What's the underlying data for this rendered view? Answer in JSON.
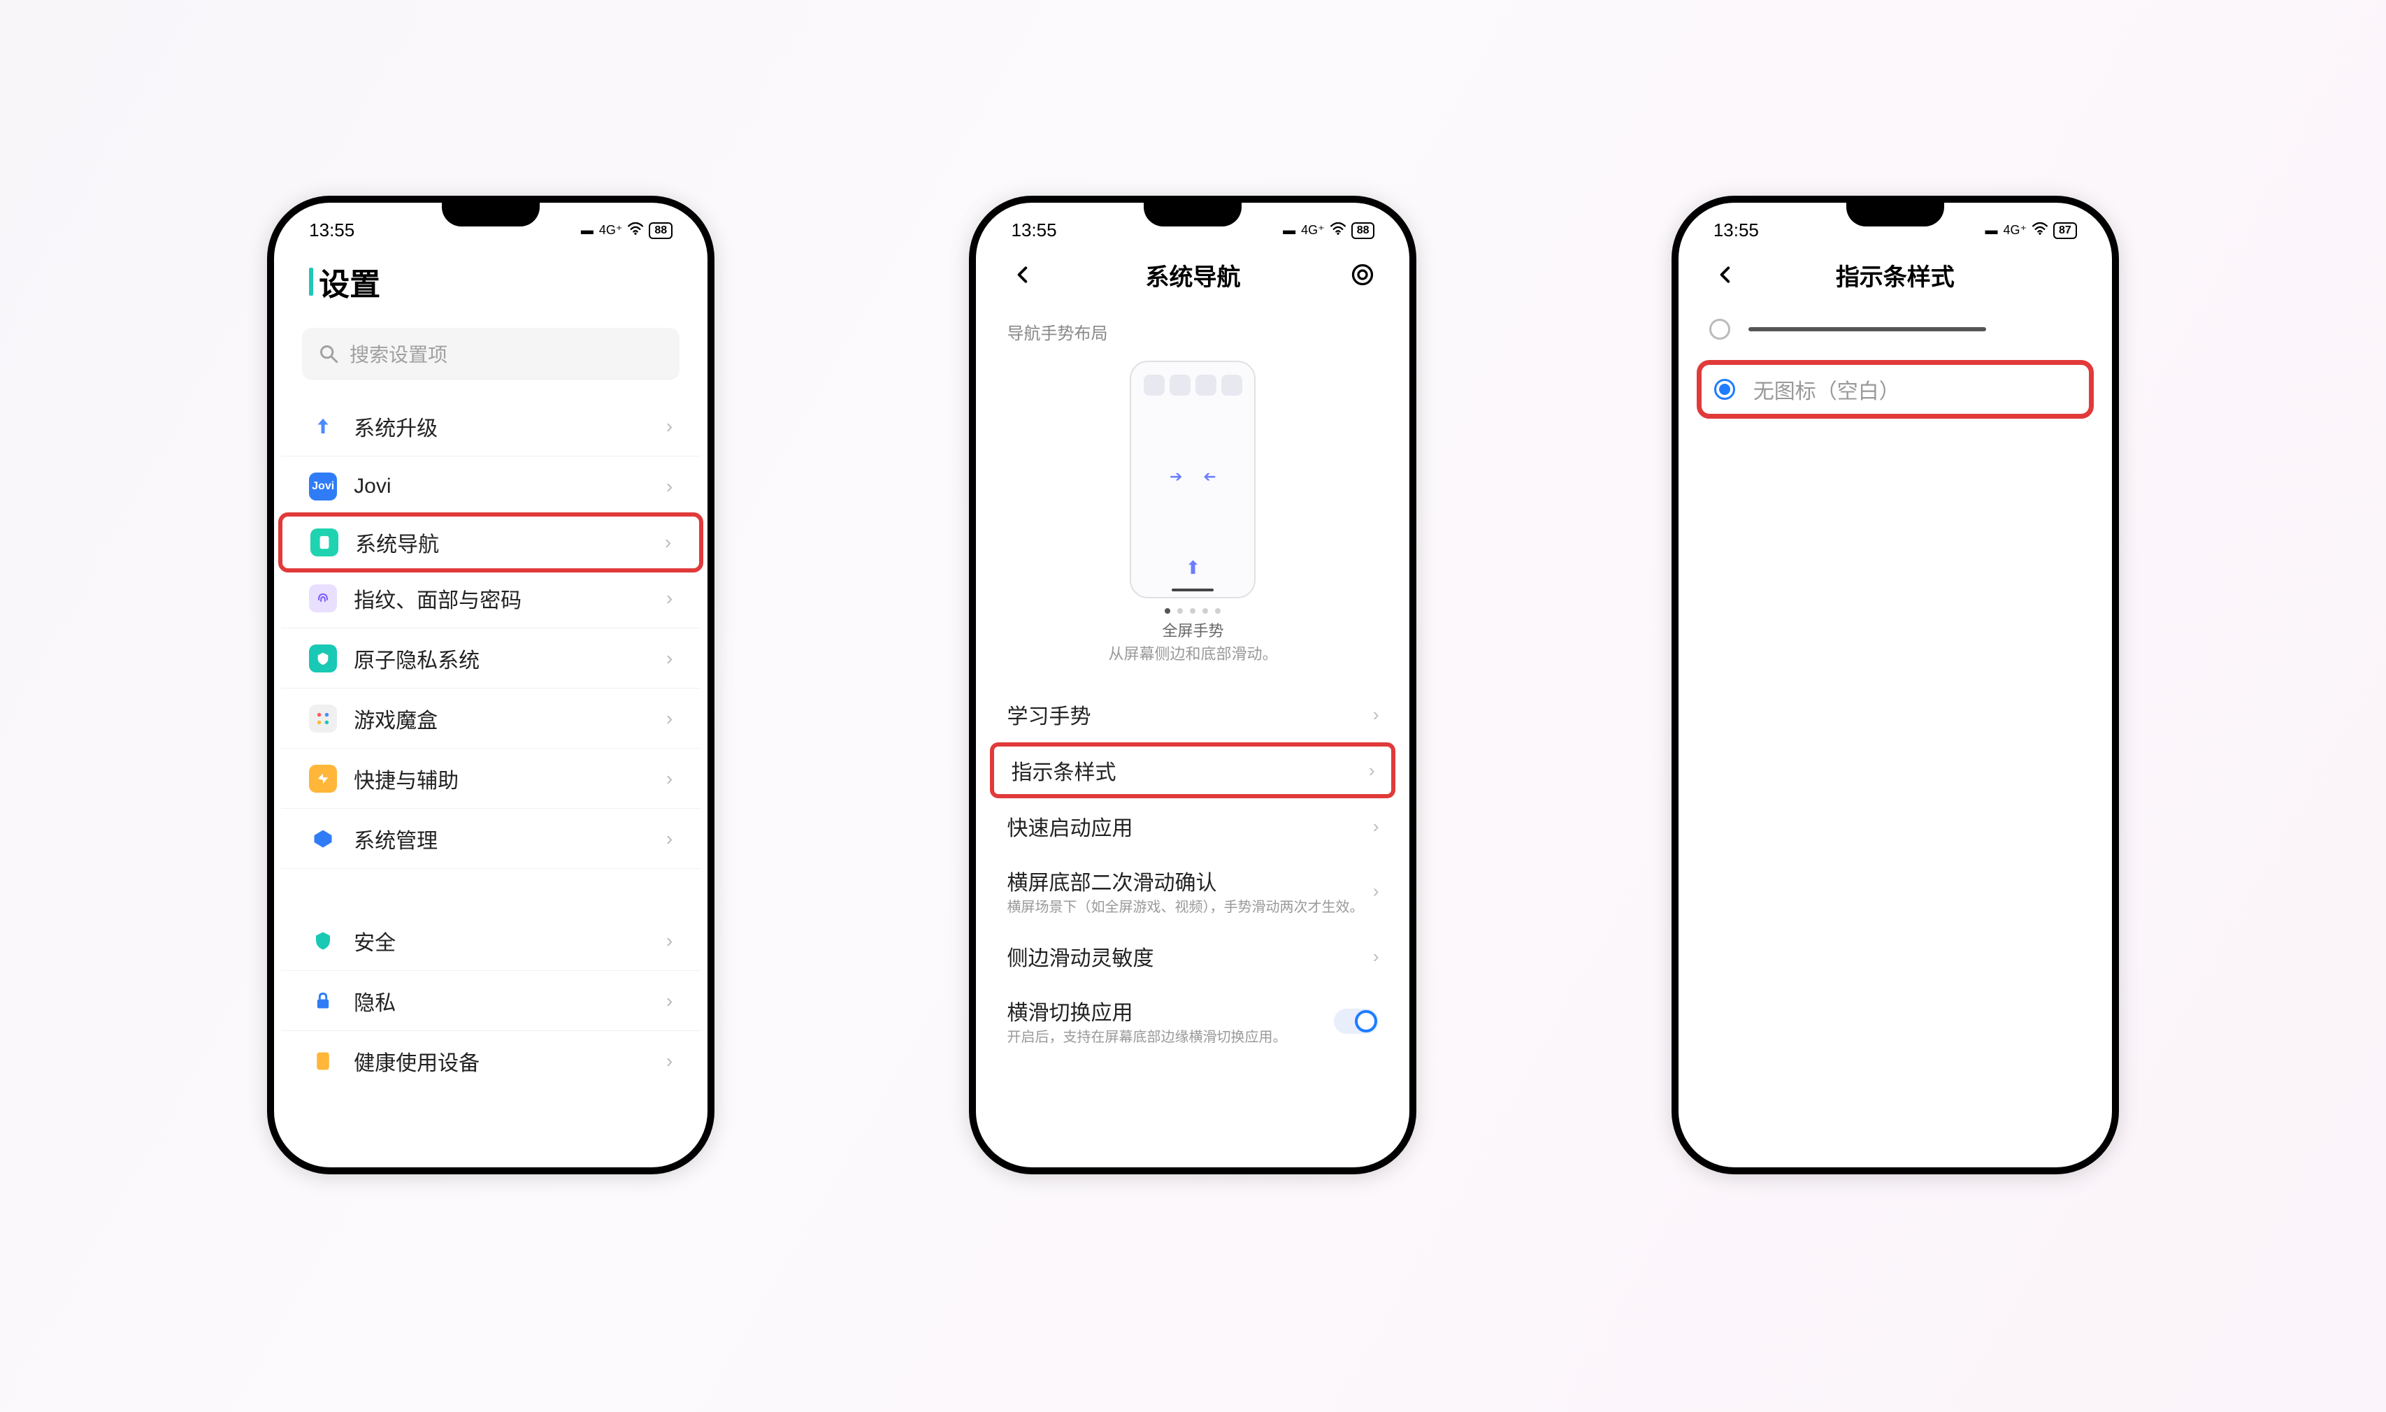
{
  "status": {
    "time": "13:55",
    "battery1": "88",
    "battery2": "88",
    "battery3": "87"
  },
  "phone1": {
    "title": "设置",
    "search_placeholder": "搜索设置项",
    "items": {
      "upgrade": "系统升级",
      "jovi": "Jovi",
      "nav": "系统导航",
      "finger": "指纹、面部与密码",
      "atom": "原子隐私系统",
      "game": "游戏魔盒",
      "quick": "快捷与辅助",
      "sysmgr": "系统管理",
      "safe": "安全",
      "privacy": "隐私",
      "health": "健康使用设备"
    }
  },
  "phone2": {
    "title": "系统导航",
    "section": "导航手势布局",
    "caption_title": "全屏手势",
    "caption_sub": "从屏幕侧边和底部滑动。",
    "learn": "学习手势",
    "indicator": "指示条样式",
    "quicklaunch": "快速启动应用",
    "hslide_confirm": "横屏底部二次滑动确认",
    "hslide_confirm_desc": "横屏场景下（如全屏游戏、视频），手势滑动两次才生效。",
    "sensitivity": "侧边滑动灵敏度",
    "hswitch": "横滑切换应用",
    "hswitch_desc": "开启后，支持在屏幕底部边缘横滑切换应用。"
  },
  "phone3": {
    "title": "指示条样式",
    "opt_blank": "无图标（空白）"
  }
}
